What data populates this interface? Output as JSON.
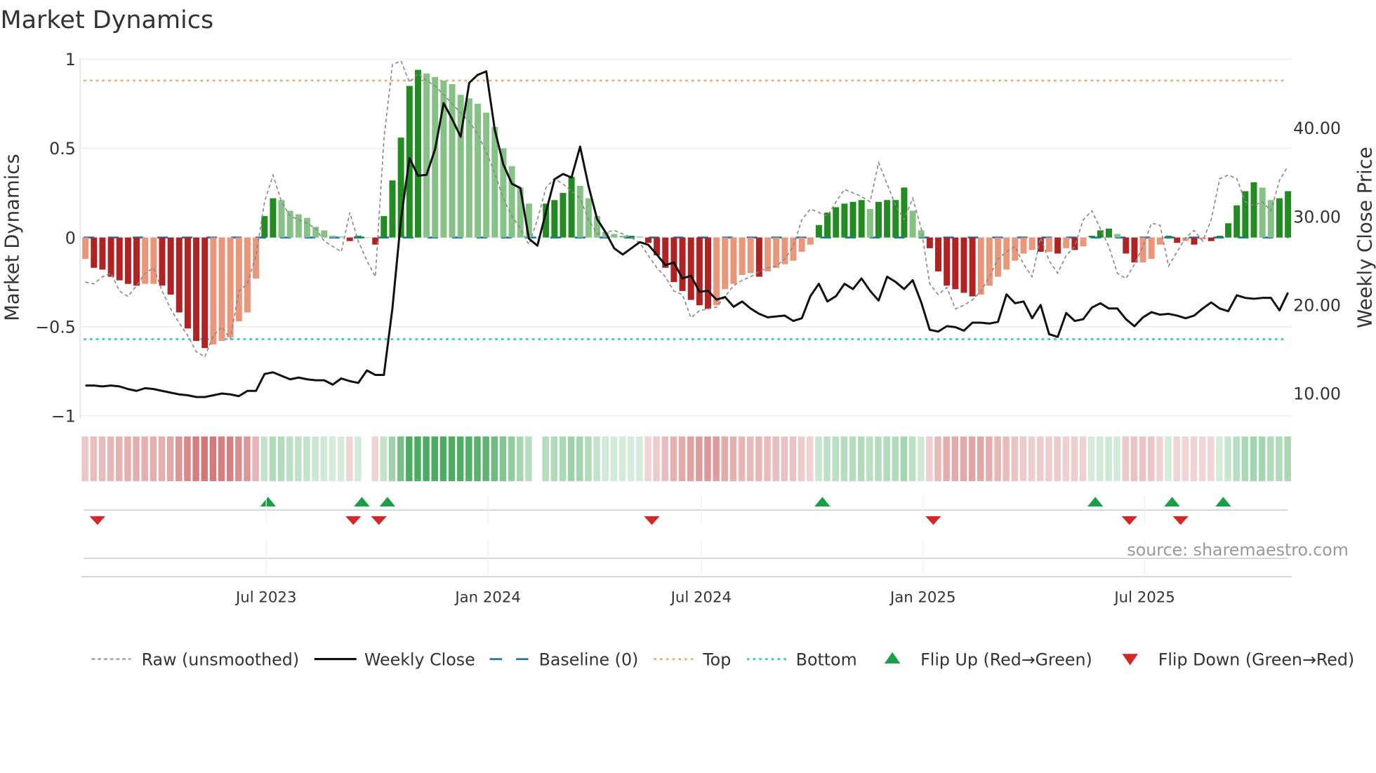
{
  "chart_data": {
    "type": "bar",
    "title": "Market Dynamics",
    "ylabel": "Market Dynamics",
    "y2label": "Weekly Close Price",
    "ylim": [
      -1,
      1
    ],
    "y2lim": [
      5,
      47
    ],
    "yticks": [
      "1",
      "0.5",
      "0",
      "−0.5",
      "−1"
    ],
    "ytick_values": [
      1,
      0.5,
      0,
      -0.5,
      -1
    ],
    "y2ticks": [
      "40.00",
      "30.00",
      "20.00",
      "10.00"
    ],
    "y2tick_values": [
      40,
      30,
      20,
      10
    ],
    "xticks": [
      "Jul 2023",
      "Jan 2024",
      "Jul 2024",
      "Jan 2025",
      "Jul 2025"
    ],
    "xtick_weeks": [
      21,
      47,
      72,
      98,
      124
    ],
    "weeks": 142,
    "top_level": 0.88,
    "bottom_level": -0.57,
    "baseline": 0,
    "smoothed": [
      -0.12,
      -0.17,
      -0.18,
      -0.22,
      -0.24,
      -0.26,
      -0.27,
      -0.26,
      -0.26,
      -0.27,
      -0.32,
      -0.42,
      -0.51,
      -0.58,
      -0.62,
      -0.6,
      -0.58,
      -0.56,
      -0.47,
      -0.42,
      -0.23,
      0.12,
      0.22,
      0.21,
      0.15,
      0.13,
      0.11,
      0.06,
      0.04,
      0.01,
      0.005,
      -0.02,
      0.01,
      0.0,
      -0.04,
      0.12,
      0.32,
      0.56,
      0.85,
      0.94,
      0.92,
      0.9,
      0.88,
      0.86,
      0.8,
      0.78,
      0.75,
      0.7,
      0.62,
      0.5,
      0.4,
      0.28,
      0.19,
      0.0,
      0.19,
      0.21,
      0.25,
      0.34,
      0.29,
      0.22,
      0.12,
      0.03,
      0.02,
      0.01,
      0.01,
      0.005,
      -0.03,
      -0.1,
      -0.17,
      -0.25,
      -0.3,
      -0.35,
      -0.38,
      -0.4,
      -0.38,
      -0.29,
      -0.26,
      -0.21,
      -0.2,
      -0.22,
      -0.19,
      -0.17,
      -0.15,
      -0.13,
      -0.08,
      -0.04,
      0.07,
      0.14,
      0.17,
      0.19,
      0.2,
      0.21,
      0.16,
      0.2,
      0.21,
      0.21,
      0.28,
      0.15,
      0.04,
      -0.06,
      -0.19,
      -0.27,
      -0.29,
      -0.31,
      -0.33,
      -0.32,
      -0.27,
      -0.22,
      -0.18,
      -0.13,
      -0.09,
      -0.07,
      -0.08,
      -0.08,
      -0.09,
      -0.06,
      -0.07,
      -0.05,
      0.01,
      0.04,
      0.05,
      0.02,
      -0.09,
      -0.14,
      -0.14,
      -0.12,
      -0.04,
      0.01,
      -0.03,
      -0.02,
      -0.04,
      -0.01,
      -0.02,
      0.01,
      0.08,
      0.18,
      0.26,
      0.31,
      0.28,
      0.21,
      0.22,
      0.26
    ],
    "raw": [
      -0.25,
      -0.26,
      -0.22,
      -0.2,
      -0.3,
      -0.33,
      -0.27,
      -0.2,
      -0.17,
      -0.3,
      -0.4,
      -0.48,
      -0.55,
      -0.64,
      -0.67,
      -0.55,
      -0.5,
      -0.57,
      -0.3,
      -0.26,
      -0.1,
      0.2,
      0.35,
      0.2,
      0.12,
      0.1,
      0.08,
      0.05,
      -0.02,
      -0.05,
      -0.08,
      0.14,
      -0.02,
      -0.13,
      -0.22,
      0.55,
      0.97,
      0.99,
      0.87,
      0.92,
      0.88,
      0.85,
      0.8,
      0.75,
      0.7,
      0.65,
      0.58,
      0.48,
      0.36,
      0.22,
      0.12,
      0.05,
      -0.04,
      0.1,
      0.28,
      0.33,
      0.3,
      0.26,
      0.22,
      0.1,
      0.02,
      0.03,
      0.04,
      0.02,
      0.0,
      -0.03,
      -0.1,
      -0.17,
      -0.22,
      -0.3,
      -0.32,
      -0.45,
      -0.41,
      -0.4,
      -0.39,
      -0.33,
      -0.27,
      -0.24,
      -0.22,
      -0.19,
      -0.17,
      -0.16,
      -0.12,
      -0.05,
      0.1,
      0.16,
      0.14,
      0.12,
      0.2,
      0.27,
      0.25,
      0.23,
      0.2,
      0.42,
      0.3,
      0.18,
      0.1,
      0.22,
      0.05,
      -0.26,
      -0.32,
      -0.28,
      -0.4,
      -0.38,
      -0.35,
      -0.3,
      -0.22,
      -0.12,
      -0.08,
      -0.05,
      -0.15,
      -0.22,
      0.0,
      -0.13,
      -0.2,
      -0.1,
      -0.05,
      0.1,
      0.15,
      0.05,
      -0.05,
      -0.2,
      -0.23,
      -0.15,
      -0.05,
      0.08,
      0.07,
      -0.16,
      -0.08,
      0.0,
      0.04,
      -0.02,
      0.1,
      0.33,
      0.35,
      0.33,
      0.2,
      0.18,
      0.2,
      0.15,
      0.32,
      0.4
    ],
    "close": [
      10.9,
      10.9,
      10.8,
      10.9,
      10.8,
      10.5,
      10.3,
      10.6,
      10.5,
      10.3,
      10.1,
      9.9,
      9.8,
      9.6,
      9.6,
      9.8,
      10.0,
      9.9,
      9.7,
      10.3,
      10.3,
      12.2,
      12.4,
      12.0,
      11.6,
      11.8,
      11.6,
      11.5,
      11.5,
      11.0,
      11.7,
      11.4,
      11.2,
      12.6,
      12.1,
      12.1,
      19.6,
      29.7,
      36.6,
      34.6,
      34.7,
      37.6,
      42.8,
      41.0,
      39.0,
      45.1,
      46.0,
      46.4,
      39.8,
      35.9,
      33.7,
      33.2,
      27.5,
      26.7,
      30.5,
      34.2,
      34.8,
      34.4,
      37.9,
      33.4,
      29.7,
      28.2,
      26.4,
      25.7,
      26.4,
      27.1,
      26.8,
      25.7,
      24.5,
      24.8,
      23.0,
      23.3,
      21.5,
      21.6,
      20.6,
      20.9,
      19.8,
      20.4,
      19.6,
      19.0,
      18.6,
      18.7,
      18.8,
      18.2,
      18.5,
      21.0,
      22.4,
      20.4,
      21.0,
      22.4,
      21.8,
      23.0,
      21.6,
      20.5,
      23.2,
      22.6,
      21.8,
      22.8,
      20.3,
      17.2,
      17.0,
      17.6,
      17.5,
      17.1,
      18.0,
      18.0,
      17.9,
      18.1,
      21.2,
      20.2,
      20.4,
      18.5,
      20.0,
      16.7,
      16.4,
      19.1,
      18.2,
      18.4,
      19.7,
      20.2,
      19.6,
      19.6,
      18.4,
      17.6,
      18.6,
      19.2,
      18.9,
      19.0,
      18.8,
      18.5,
      18.8,
      19.6,
      20.3,
      19.6,
      19.3,
      21.1,
      20.8,
      20.7,
      20.8,
      20.8,
      19.4,
      21.4
    ],
    "flip_up_weeks": [
      21,
      32,
      35,
      86,
      118,
      127,
      133
    ],
    "flip_down_weeks": [
      1,
      31,
      34,
      66,
      99,
      122,
      128
    ],
    "legend": {
      "placement": "bottom",
      "entries": [
        "Raw (unsmoothed)",
        "Weekly Close",
        "Baseline (0)",
        "Top",
        "Bottom",
        "Flip Up (Red→Green)",
        "Flip Down (Green→Red)"
      ]
    },
    "source": "source: sharemaestro.com"
  },
  "colors": {
    "up_strong": "#228b22",
    "up_weak": "#86c286",
    "down_strong": "#b22222",
    "down_weak": "#e9967a",
    "raw": "#888888",
    "close": "#111111",
    "baseline": "#1f77b4",
    "top": "#f0a868",
    "bottom": "#22c4d4",
    "flip_up": "#1a9e48",
    "flip_down": "#d62728"
  }
}
